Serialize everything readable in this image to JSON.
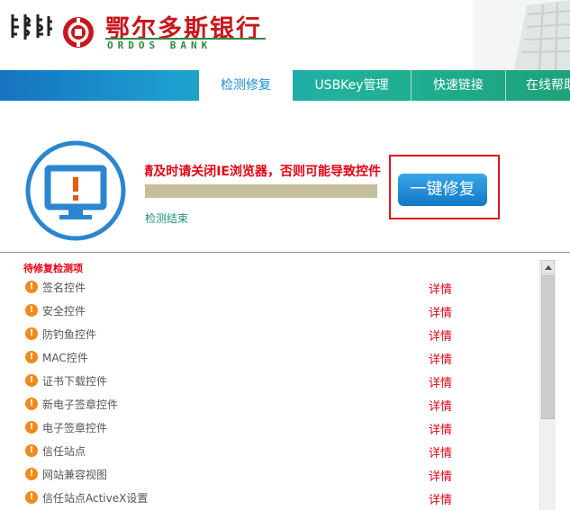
{
  "header": {
    "bank_name_cn": "鄂尔多斯银行",
    "bank_name_en": "ORDOS BANK"
  },
  "nav": {
    "tabs": [
      {
        "label": "检测修复",
        "active": true
      },
      {
        "label": "USBKey管理",
        "active": false
      },
      {
        "label": "快速链接",
        "active": false
      },
      {
        "label": "在线帮助",
        "active": false
      }
    ]
  },
  "status": {
    "warning": "提示：修复过程中请及时请关闭IE浏览器，否则可能导致控件",
    "progress": 1.0,
    "result": "检测结束",
    "fix_button": "一键修复",
    "monitor_icon": "monitor-warning-icon"
  },
  "list": {
    "title": "待修复检测项",
    "item_icon": "warning-icon",
    "items": [
      {
        "label": "签名控件",
        "action": "详情"
      },
      {
        "label": "安全控件",
        "action": "详情"
      },
      {
        "label": "防钓鱼控件",
        "action": "详情"
      },
      {
        "label": "MAC控件",
        "action": "详情"
      },
      {
        "label": "证书下载控件",
        "action": "详情"
      },
      {
        "label": "新电子签章控件",
        "action": "详情"
      },
      {
        "label": "电子签章控件",
        "action": "详情"
      },
      {
        "label": "信任站点",
        "action": "详情"
      },
      {
        "label": "网站兼容视图",
        "action": "详情"
      },
      {
        "label": "信任站点ActiveX设置",
        "action": "详情"
      }
    ]
  },
  "colors": {
    "accent_red": "#e60012",
    "nav_blue": "#1673c1",
    "nav_green": "#1ea27a",
    "warning_orange": "#f08a1c"
  }
}
